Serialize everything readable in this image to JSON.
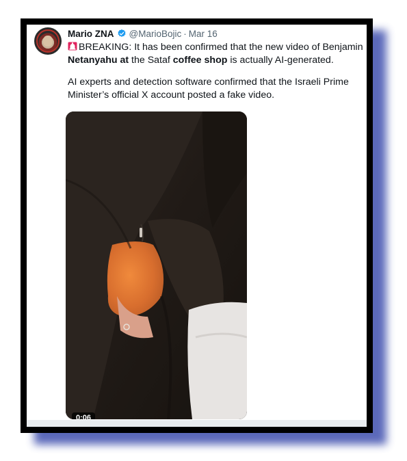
{
  "tweet": {
    "author": {
      "display_name": "Mario ZNA",
      "handle": "@MarioBojic",
      "verified": true,
      "avatar_icon": "avatar-image"
    },
    "date": "Mar 16",
    "separator": "·",
    "paragraph1": {
      "icon": "siren-icon",
      "t1": "BREAKING: It has been confirmed that the new video of Benjamin ",
      "b1": "Netanyahu at",
      "t2": " the Sataf ",
      "b2": "coffee shop",
      "t3": " is actually AI-generated."
    },
    "paragraph2": "AI experts and detection software confirmed that the Israeli Prime Minister’s official X account posted a fake video.",
    "media": {
      "type": "video",
      "duration": "0:06"
    }
  },
  "colors": {
    "frame": "#000000",
    "shadow": "#3f4fae",
    "verified_blue": "#1d9bf0",
    "muted_text": "#536471",
    "text": "#0f1419"
  }
}
